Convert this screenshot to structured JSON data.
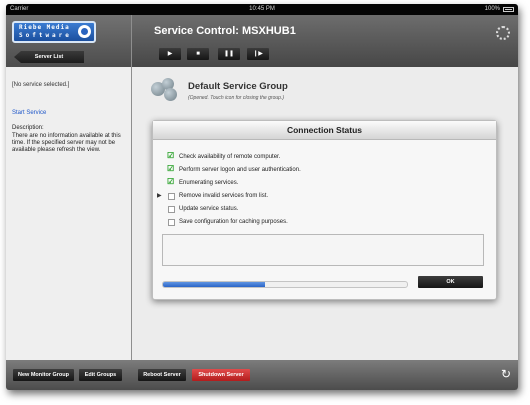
{
  "status_bar": {
    "carrier": "Carrier",
    "time": "10:45 PM",
    "battery": "100%"
  },
  "sidebar": {
    "logo_line1": "Riebe Media",
    "logo_line2": "Software",
    "back_button": "Server List",
    "no_service": "[No service selected.]",
    "start_service": "Start Service",
    "description_label": "Description:",
    "description_text": "There are no information available at this time. If the specified server may not be available please refresh the view."
  },
  "header": {
    "title": "Service Control: MSXHUB1",
    "controls": [
      {
        "name": "play-button",
        "glyph": "▶"
      },
      {
        "name": "stop-button",
        "glyph": "■"
      },
      {
        "name": "pause-button",
        "glyph": "❚❚"
      },
      {
        "name": "step-button",
        "glyph": "❙▶"
      }
    ]
  },
  "group": {
    "title": "Default Service Group",
    "subtitle": "(Opened. Touch icon for closing the group.)"
  },
  "dialog": {
    "title": "Connection Status",
    "steps": [
      {
        "label": "Check availability of remote computer.",
        "checked": true,
        "current": false
      },
      {
        "label": "Perform server logon and user authentication.",
        "checked": true,
        "current": false
      },
      {
        "label": "Enumerating services.",
        "checked": true,
        "current": false
      },
      {
        "label": "Remove invalid services from list.",
        "checked": false,
        "current": true
      },
      {
        "label": "Update service status.",
        "checked": false,
        "current": false
      },
      {
        "label": "Save configuration for caching purposes.",
        "checked": false,
        "current": false
      }
    ],
    "progress": 0.42,
    "ok_label": "OK"
  },
  "bottom_bar": {
    "buttons": [
      {
        "name": "new-monitor-group-button",
        "label": "New Monitor Group"
      },
      {
        "name": "edit-groups-button",
        "label": "Edit Groups"
      },
      {
        "name": "reboot-server-button",
        "label": "Reboot Server"
      },
      {
        "name": "shutdown-server-button",
        "label": "Shutdown Server"
      }
    ],
    "refresh_icon": "refresh-icon"
  },
  "colors": {
    "accent_blue": "#1f57c9",
    "danger_red": "#c62828",
    "check_green": "#25a025"
  }
}
